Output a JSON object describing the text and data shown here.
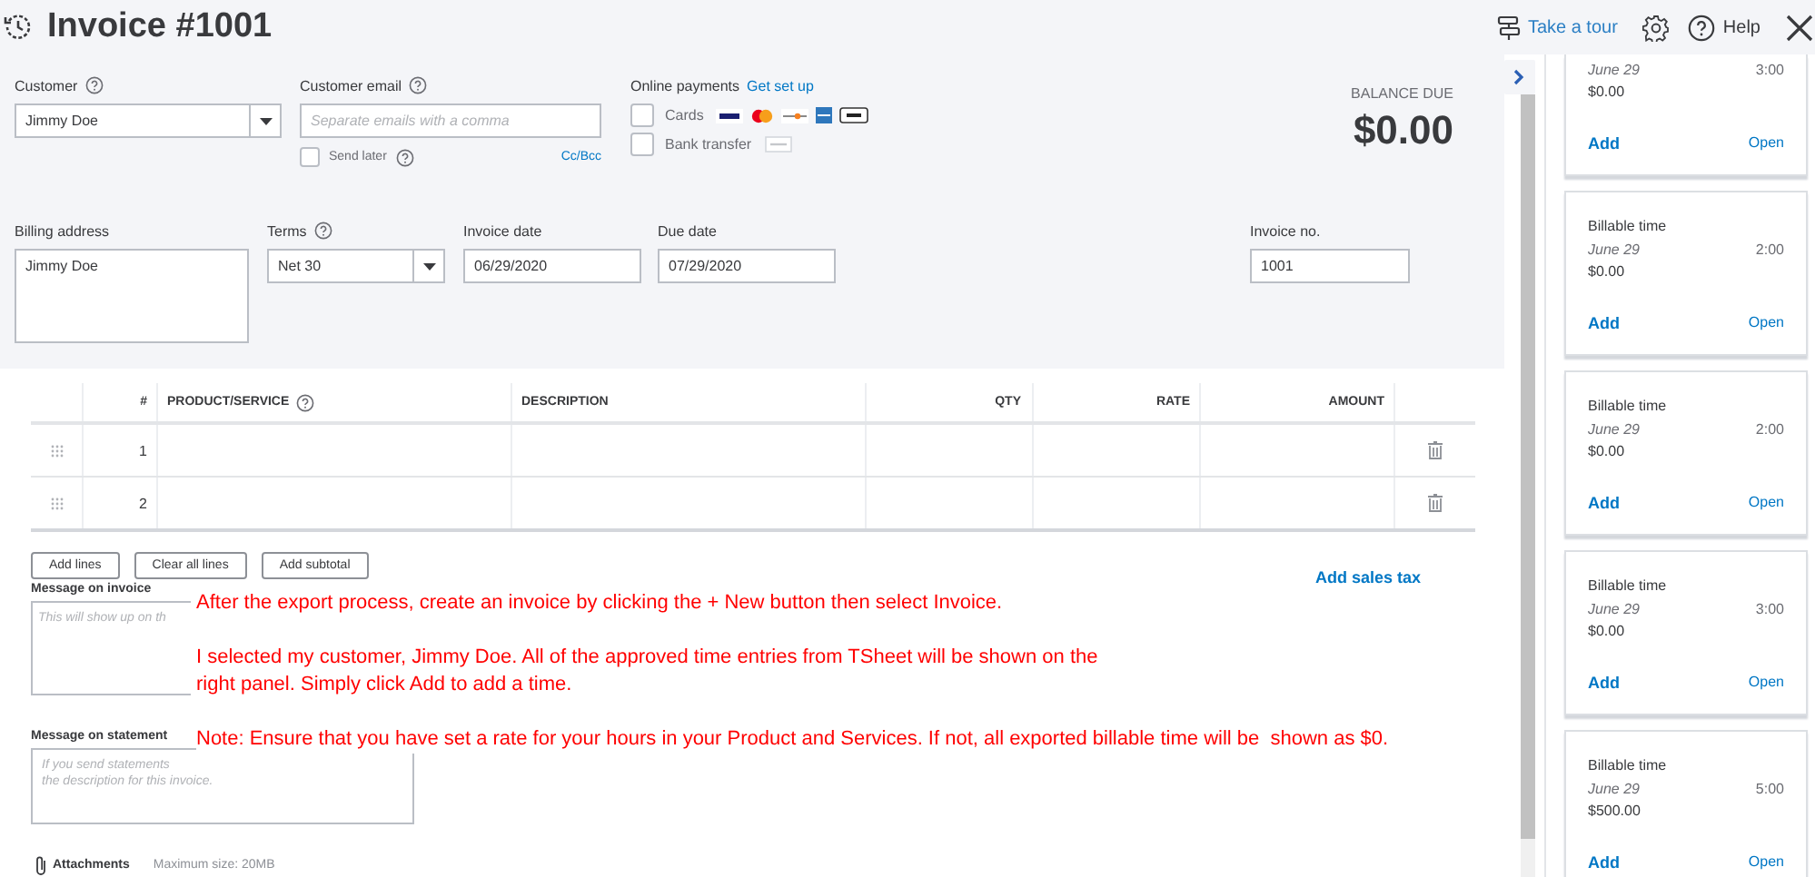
{
  "header": {
    "title": "Invoice #1001",
    "tour_link": "Take a tour",
    "help_label": "Help"
  },
  "customer": {
    "label": "Customer",
    "help": true,
    "value": "Jimmy Doe"
  },
  "email": {
    "label": "Customer email",
    "help": true,
    "placeholder": "Separate emails with a comma",
    "send_later": {
      "label": "Send later",
      "help": true,
      "checked": false
    },
    "cc_link": "Cc/Bcc"
  },
  "online_payments": {
    "label": "Online payments",
    "setup_link": "Get set up",
    "options": [
      {
        "kind": "cards",
        "label": "Cards",
        "checked": false
      },
      {
        "kind": "bank",
        "label": "Bank transfer",
        "checked": false
      }
    ]
  },
  "balance": {
    "label": "BALANCE DUE",
    "amount": "$0.00"
  },
  "billing": {
    "label": "Billing address",
    "value": "Jimmy Doe"
  },
  "terms": {
    "label": "Terms",
    "help": true,
    "value": "Net 30"
  },
  "invoice_date": {
    "label": "Invoice date",
    "value": "06/29/2020"
  },
  "due_date": {
    "label": "Due date",
    "value": "07/29/2020"
  },
  "invoice_no": {
    "label": "Invoice no.",
    "value": "1001"
  },
  "table": {
    "columns": [
      {
        "label": "#"
      },
      {
        "label": "PRODUCT/SERVICE",
        "help": true
      },
      {
        "label": "DESCRIPTION"
      },
      {
        "label": "QTY"
      },
      {
        "label": "RATE"
      },
      {
        "label": "AMOUNT"
      }
    ],
    "rows": [
      {
        "number": "1"
      },
      {
        "number": "2"
      }
    ]
  },
  "table_buttons": [
    "Add lines",
    "Clear all lines",
    "Add subtotal"
  ],
  "sales_tax_link": "Add sales tax",
  "message_invoice": {
    "label": "Message on invoice",
    "placeholder": "This will show up on th"
  },
  "message_statement": {
    "label": "Message on statement",
    "placeholder": "If you send statements\nthe description for this invoice."
  },
  "attachments": {
    "label": "Attachments",
    "hint": "Maximum size: 20MB"
  },
  "annotation": [
    "After the export process, create an invoice by clicking the + New button then select Invoice.",
    "I selected my customer, Jimmy Doe. All of the approved time entries from TSheet will be shown on the\nright panel. Simply click Add to add a time.",
    "Note: Ensure that you have set a rate for your hours in your Product and Services. If not, all exported billable time will be  shown as $0."
  ],
  "time_panel": {
    "cards": [
      {
        "date": "June 29",
        "duration": "3:00",
        "amount": "$0.00",
        "add": "Add",
        "open": "Open"
      },
      {
        "title": "Billable time",
        "date": "June 29",
        "duration": "2:00",
        "amount": "$0.00",
        "add": "Add",
        "open": "Open"
      },
      {
        "title": "Billable time",
        "date": "June 29",
        "duration": "2:00",
        "amount": "$0.00",
        "add": "Add",
        "open": "Open"
      },
      {
        "title": "Billable time",
        "date": "June 29",
        "duration": "3:00",
        "amount": "$0.00",
        "add": "Add",
        "open": "Open"
      },
      {
        "title": "Billable time",
        "date": "June 29",
        "duration": "5:00",
        "amount": "$500.00",
        "add": "Add",
        "open": "Open"
      }
    ]
  }
}
